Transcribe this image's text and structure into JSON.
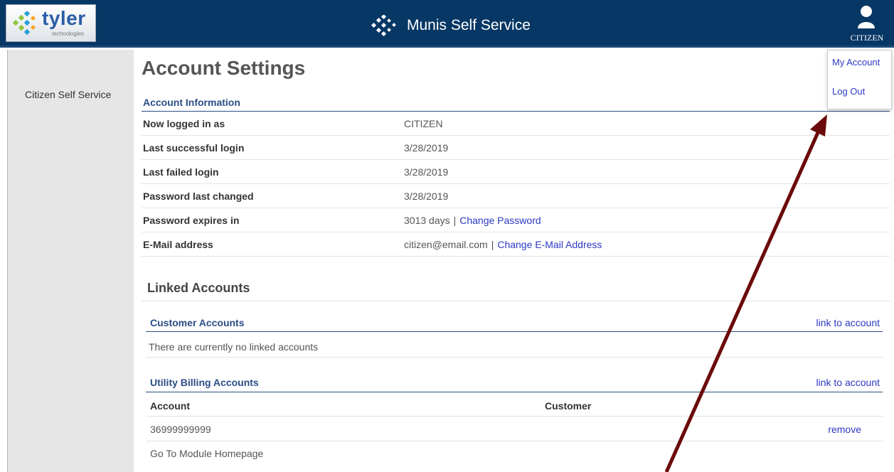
{
  "header": {
    "logo_text": "tyler",
    "logo_sub": "technologies",
    "app_title": "Munis Self Service",
    "user_label": "CITIZEN"
  },
  "sidebar": {
    "items": [
      {
        "label": "Citizen Self Service"
      }
    ]
  },
  "user_menu": {
    "items": [
      {
        "label": "My Account"
      },
      {
        "label": "Log Out"
      }
    ]
  },
  "main": {
    "title": "Account Settings",
    "account_info": {
      "heading": "Account Information",
      "rows": [
        {
          "label": "Now logged in as",
          "value": "CITIZEN"
        },
        {
          "label": "Last successful login",
          "value": "3/28/2019"
        },
        {
          "label": "Last failed login",
          "value": "3/28/2019"
        },
        {
          "label": "Password last changed",
          "value": "3/28/2019"
        },
        {
          "label": "Password expires in",
          "value": "3013 days",
          "separator": "|",
          "link": "Change Password"
        },
        {
          "label": "E-Mail address",
          "value": "citizen@email.com",
          "separator": "|",
          "link": "Change E-Mail Address"
        }
      ]
    },
    "linked": {
      "title": "Linked Accounts",
      "customer": {
        "heading": "Customer Accounts",
        "link": "link to account",
        "empty_text": "There are currently no linked accounts"
      },
      "utility": {
        "heading": "Utility Billing Accounts",
        "link": "link to account",
        "columns": [
          "Account",
          "Customer"
        ],
        "rows": [
          {
            "account": "36999999999",
            "customer": "",
            "action": "remove"
          }
        ]
      },
      "module_link": "Go To Module Homepage"
    }
  },
  "colors": {
    "header_bg": "#073765",
    "section_heading": "#2b4d86",
    "link": "#2c39c2",
    "sidebar_bg": "#e6e6e6",
    "annotation_arrow": "#6b0a0a"
  },
  "icons": [
    "tyler-logo-icon",
    "munis-logo-icon",
    "user-icon",
    "annotation-arrow"
  ]
}
